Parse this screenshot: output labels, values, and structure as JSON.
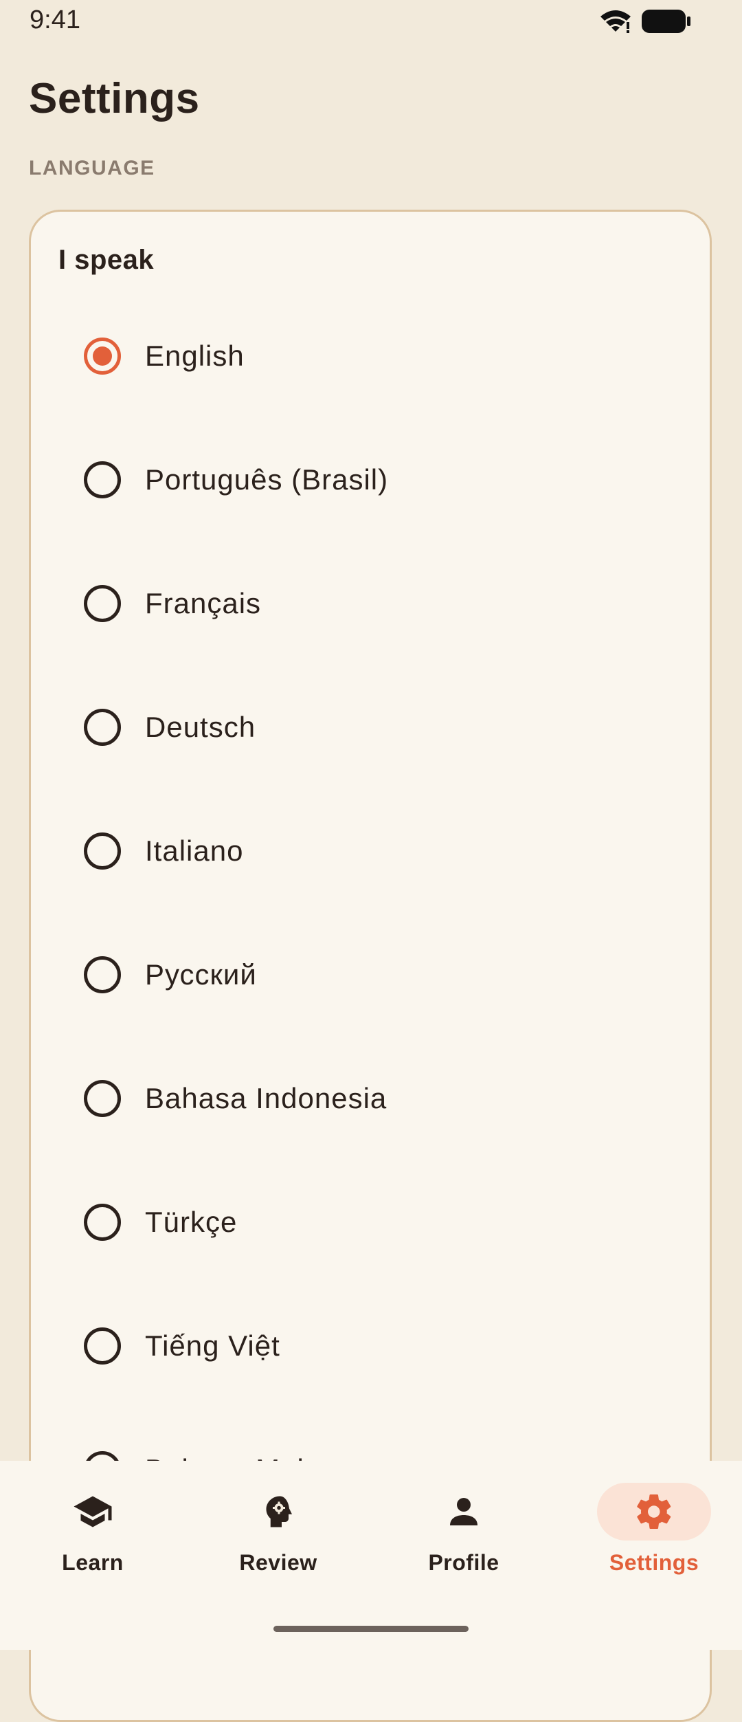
{
  "status_bar": {
    "time": "9:41",
    "wifi_icon": "wifi-icon",
    "battery_icon": "battery-icon"
  },
  "page": {
    "title": "Settings",
    "section_header": "LANGUAGE"
  },
  "language_card": {
    "title": "I speak",
    "selected": "English",
    "options": [
      {
        "label": "English",
        "checked": true
      },
      {
        "label": "Português (Brasil)",
        "checked": false
      },
      {
        "label": "Français",
        "checked": false
      },
      {
        "label": "Deutsch",
        "checked": false
      },
      {
        "label": "Italiano",
        "checked": false
      },
      {
        "label": "Русский",
        "checked": false
      },
      {
        "label": "Bahasa Indonesia",
        "checked": false
      },
      {
        "label": "Türkçe",
        "checked": false
      },
      {
        "label": "Tiếng Việt",
        "checked": false
      },
      {
        "label": "Bahasa Melayu",
        "checked": false
      }
    ]
  },
  "bottom_nav": {
    "items": [
      {
        "label": "Learn",
        "icon": "graduation-cap-icon",
        "active": false
      },
      {
        "label": "Review",
        "icon": "brain-head-icon",
        "active": false
      },
      {
        "label": "Profile",
        "icon": "person-icon",
        "active": false
      },
      {
        "label": "Settings",
        "icon": "gear-icon",
        "active": true
      }
    ]
  },
  "colors": {
    "background": "#F2EADB",
    "card": "#FAF6EE",
    "card_border": "#DCC3A0",
    "accent": "#E2603A",
    "text": "#2B211C",
    "muted": "#8A7B6E"
  }
}
